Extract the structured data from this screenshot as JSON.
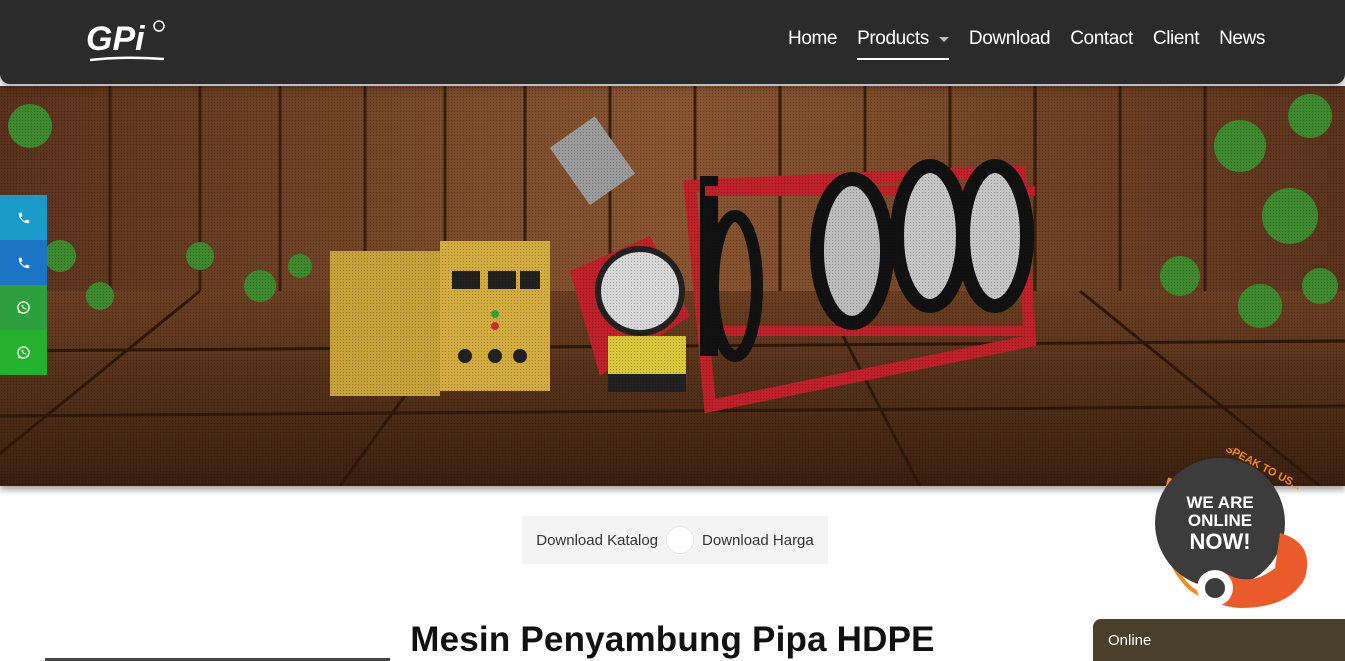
{
  "brand": {
    "logo_text": "GPi"
  },
  "nav": {
    "items": [
      {
        "label": "Home"
      },
      {
        "label": "Products"
      },
      {
        "label": "Download"
      },
      {
        "label": "Contact"
      },
      {
        "label": "Client"
      },
      {
        "label": "News"
      }
    ]
  },
  "side_contacts": [
    {
      "icon": "phone-icon",
      "color": "#1a9bc7"
    },
    {
      "icon": "phone-icon",
      "color": "#1e74c4"
    },
    {
      "icon": "whatsapp-icon",
      "color": "#2e9e3e"
    },
    {
      "icon": "whatsapp-icon",
      "color": "#25b02e"
    }
  ],
  "downloads": {
    "catalog_label": "Download Katalog",
    "price_label": "Download Harga"
  },
  "page": {
    "title": "Mesin Penyambung Pipa HDPE"
  },
  "chat": {
    "badge_top": "SPEAK TO US...",
    "badge_line1": "WE ARE",
    "badge_line2": "ONLINE",
    "badge_line3": "NOW!",
    "status_label": "Online"
  },
  "colors": {
    "navbar": "#2b2b2b",
    "chat_bar": "#4a3f2b",
    "accent_orange": "#f08a24"
  }
}
